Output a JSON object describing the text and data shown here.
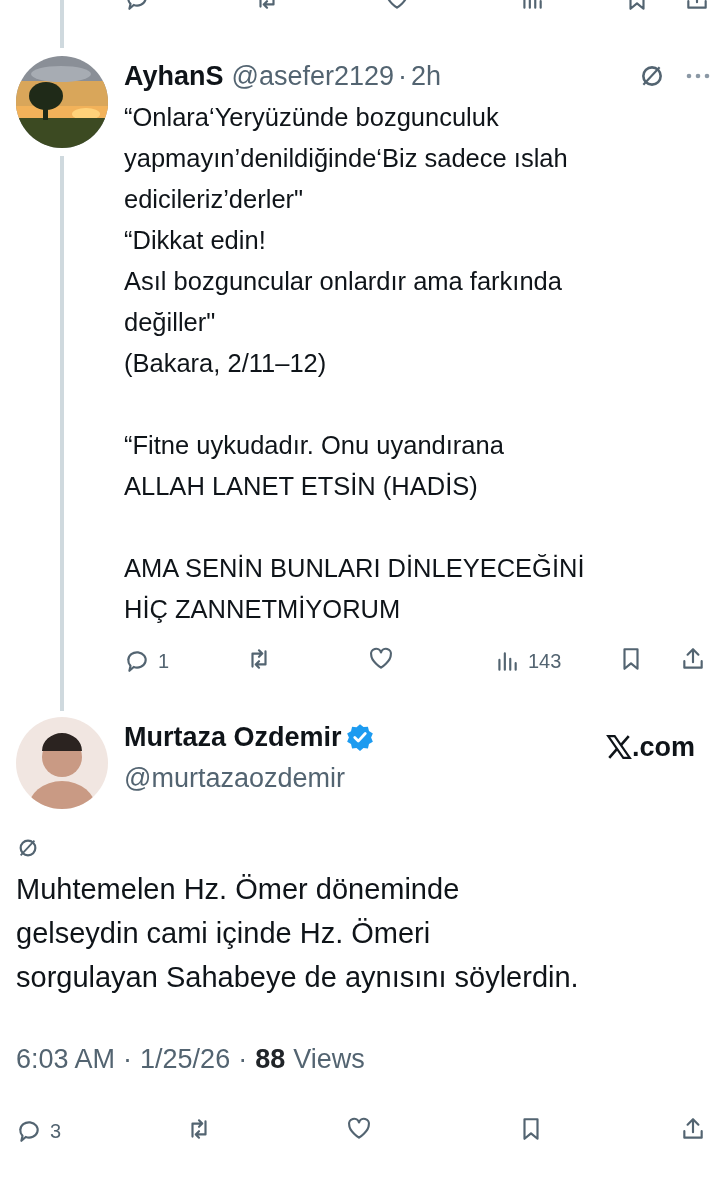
{
  "prev_tweet_actions": [
    {
      "kind": "reply"
    },
    {
      "kind": "repost"
    },
    {
      "kind": "like"
    },
    {
      "kind": "views"
    },
    {
      "kind": "bookmark"
    },
    {
      "kind": "share"
    }
  ],
  "reply_tweet": {
    "name": "AyhanS",
    "handle": "@asefer2129",
    "separator": "·",
    "time": "2h",
    "text": "“Onlara‘Yeryüzünde bozgunculuk\nyapmayın’denildiğinde‘Biz sadece ıslah\nedicileriz’derler\"\n“Dikkat edin!\nAsıl bozguncular onlardır ama farkında\ndeğiller\"\n(Bakara, 2/11–12)\n\n“Fitne uykudadır. Onu uyandırana\nALLAH LANET ETSİN (HADİS)\n\nAMA SENİN BUNLARI DİNLEYECEĞİNİ\nHİÇ ZANNETMİYORUM",
    "actions": [
      {
        "kind": "reply",
        "count": "1"
      },
      {
        "kind": "repost"
      },
      {
        "kind": "like"
      },
      {
        "kind": "views",
        "count": "143"
      },
      {
        "kind": "bookmark"
      },
      {
        "kind": "share"
      }
    ]
  },
  "main_tweet": {
    "name": "Murtaza Ozdemir",
    "verified": true,
    "handle": "@murtazaozdemir",
    "site_label": ".com",
    "text": "Muhtemelen Hz. Ömer döneminde\ngelseydin cami içinde Hz. Ömeri\nsorgulayan Sahabeye de aynısını söylerdin.",
    "time": "6:03 AM",
    "separator_1": "·",
    "date": "1/25/26",
    "separator_2": "·",
    "views_count": "88",
    "views_label": "Views",
    "actions": [
      {
        "kind": "reply",
        "count": "3"
      },
      {
        "kind": "repost"
      },
      {
        "kind": "like"
      },
      {
        "kind": "bookmark"
      },
      {
        "kind": "share"
      }
    ]
  }
}
